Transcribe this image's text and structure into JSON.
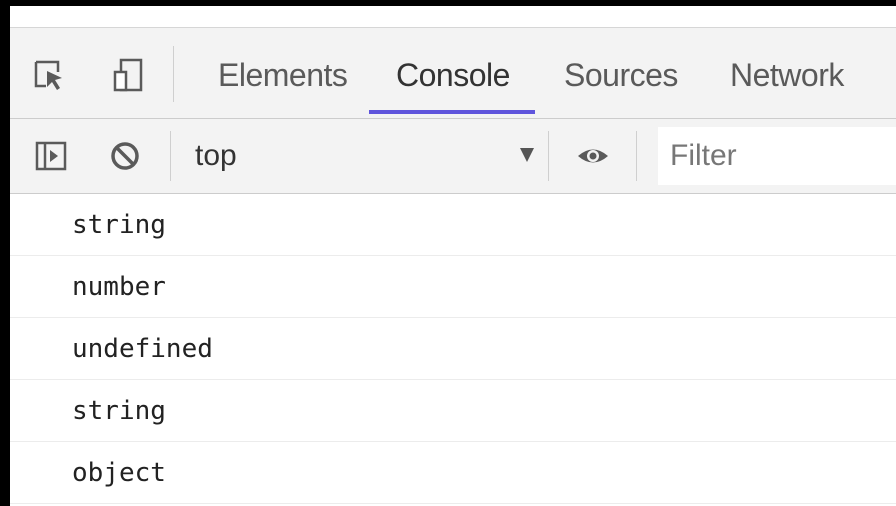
{
  "tabs": [
    {
      "label": "Elements",
      "active": false
    },
    {
      "label": "Console",
      "active": true
    },
    {
      "label": "Sources",
      "active": false
    },
    {
      "label": "Network",
      "active": false
    }
  ],
  "toolbar_icons": {
    "inspect": "inspect-element-icon",
    "device": "device-toolbar-icon",
    "sidebar": "show-sidebar-icon",
    "clear": "clear-console-icon",
    "live_expression": "eye-icon"
  },
  "console_toolbar": {
    "context": "top",
    "filter_placeholder": "Filter"
  },
  "log": [
    "string",
    "number",
    "undefined",
    "string",
    "object"
  ],
  "colors": {
    "accent": "#5f55dc",
    "toolbar_bg": "#f3f3f3"
  }
}
